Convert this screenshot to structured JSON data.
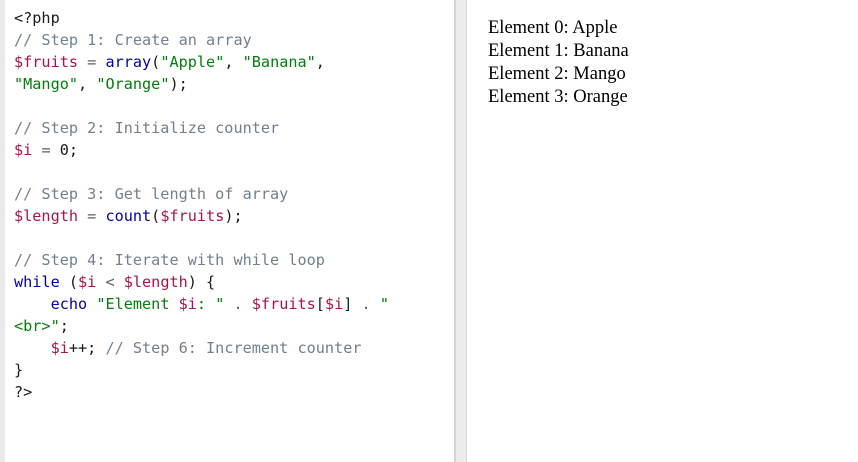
{
  "code_editor": {
    "lines": [
      [
        {
          "t": "plain",
          "v": "<?php"
        }
      ],
      [
        {
          "t": "comment",
          "v": "// Step 1: Create an array"
        }
      ],
      [
        {
          "t": "var",
          "v": "$fruits"
        },
        {
          "t": "op",
          "v": " = "
        },
        {
          "t": "func",
          "v": "array"
        },
        {
          "t": "plain",
          "v": "("
        },
        {
          "t": "str",
          "v": "\"Apple\""
        },
        {
          "t": "plain",
          "v": ", "
        },
        {
          "t": "str",
          "v": "\"Banana\""
        },
        {
          "t": "plain",
          "v": ","
        }
      ],
      [
        {
          "t": "str",
          "v": "\"Mango\""
        },
        {
          "t": "plain",
          "v": ", "
        },
        {
          "t": "str",
          "v": "\"Orange\""
        },
        {
          "t": "plain",
          "v": ");"
        }
      ],
      [],
      [
        {
          "t": "comment",
          "v": "// Step 2: Initialize counter"
        }
      ],
      [
        {
          "t": "var",
          "v": "$i"
        },
        {
          "t": "op",
          "v": " = "
        },
        {
          "t": "num",
          "v": "0"
        },
        {
          "t": "plain",
          "v": ";"
        }
      ],
      [],
      [
        {
          "t": "comment",
          "v": "// Step 3: Get length of array"
        }
      ],
      [
        {
          "t": "var",
          "v": "$length"
        },
        {
          "t": "op",
          "v": " = "
        },
        {
          "t": "func",
          "v": "count"
        },
        {
          "t": "plain",
          "v": "("
        },
        {
          "t": "var",
          "v": "$fruits"
        },
        {
          "t": "plain",
          "v": ");"
        }
      ],
      [],
      [
        {
          "t": "comment",
          "v": "// Step 4: Iterate with while loop"
        }
      ],
      [
        {
          "t": "kw",
          "v": "while"
        },
        {
          "t": "plain",
          "v": " ("
        },
        {
          "t": "var",
          "v": "$i"
        },
        {
          "t": "op",
          "v": " < "
        },
        {
          "t": "var",
          "v": "$length"
        },
        {
          "t": "plain",
          "v": ") {"
        }
      ],
      [
        {
          "t": "plain",
          "v": "    "
        },
        {
          "t": "kw",
          "v": "echo"
        },
        {
          "t": "plain",
          "v": " "
        },
        {
          "t": "str",
          "v": "\"Element "
        },
        {
          "t": "var",
          "v": "$i"
        },
        {
          "t": "str",
          "v": ": \""
        },
        {
          "t": "op",
          "v": " . "
        },
        {
          "t": "var",
          "v": "$fruits"
        },
        {
          "t": "plain",
          "v": "["
        },
        {
          "t": "var",
          "v": "$i"
        },
        {
          "t": "plain",
          "v": "]"
        },
        {
          "t": "op",
          "v": " . "
        },
        {
          "t": "str",
          "v": "\""
        }
      ],
      [
        {
          "t": "str",
          "v": "<br>\""
        },
        {
          "t": "plain",
          "v": ";"
        }
      ],
      [
        {
          "t": "plain",
          "v": "    "
        },
        {
          "t": "var",
          "v": "$i"
        },
        {
          "t": "plain",
          "v": "++; "
        },
        {
          "t": "comment",
          "v": "// Step 6: Increment counter"
        }
      ],
      [
        {
          "t": "plain",
          "v": "}"
        }
      ],
      [
        {
          "t": "plain",
          "v": "?>"
        }
      ]
    ]
  },
  "output_pane": {
    "lines": [
      "Element 0: Apple",
      "Element 1: Banana",
      "Element 2: Mango",
      "Element 3: Orange"
    ]
  },
  "colors": {
    "comment": "#708090",
    "variable": "#a9144c",
    "string": "#00800c",
    "keyword": "#0000b0",
    "background": "#ffffff",
    "divider": "#ececec"
  }
}
